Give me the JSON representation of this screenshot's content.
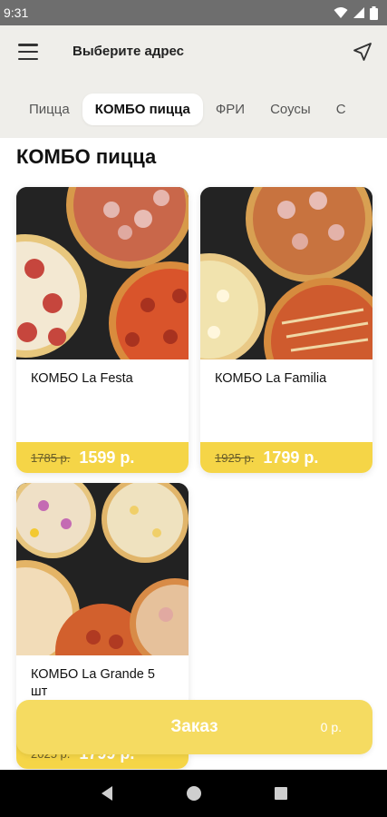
{
  "status_bar": {
    "time": "9:31"
  },
  "header": {
    "address_label": "Выберите адрес"
  },
  "tabs": [
    {
      "label": "Пицца"
    },
    {
      "label": "КОМБО пицца"
    },
    {
      "label": "ФРИ"
    },
    {
      "label": "Соусы"
    },
    {
      "label": "С"
    }
  ],
  "section_title": "КОМБО пицца",
  "products": [
    {
      "name": "КОМБО La Festa",
      "old_price": "1785 р.",
      "price": "1599 р."
    },
    {
      "name": "КОМБО La Familia",
      "old_price": "1925 р.",
      "price": "1799 р."
    },
    {
      "name": "КОМБО La Grande 5 шт",
      "old_price": "2025 р.",
      "price": "1799 р."
    }
  ],
  "order": {
    "label": "Заказ",
    "sum": "0 р."
  },
  "colors": {
    "accent": "#f5d547",
    "header_bg": "#efeeea"
  }
}
